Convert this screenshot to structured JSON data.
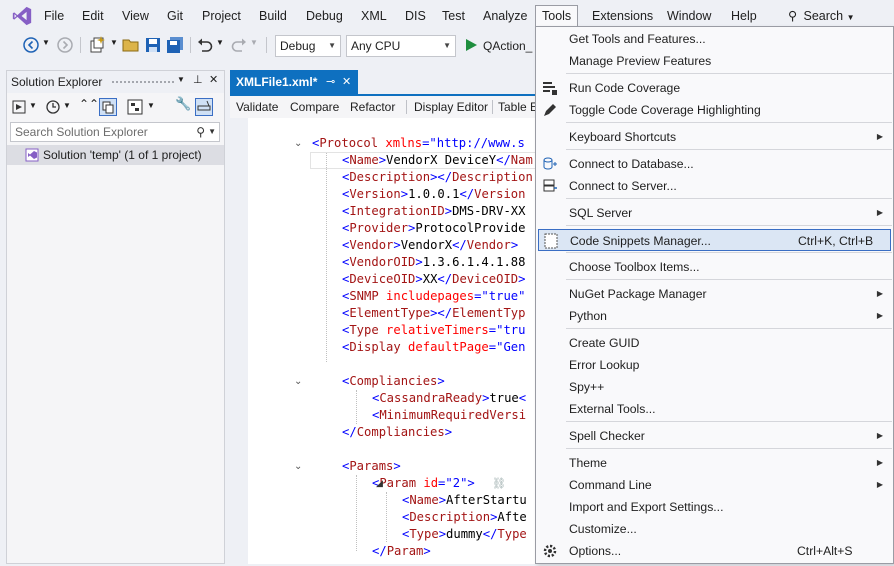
{
  "menubar": {
    "items": [
      "File",
      "Edit",
      "View",
      "Git",
      "Project",
      "Build",
      "Debug",
      "XML",
      "DIS",
      "Test",
      "Analyze",
      "Tools",
      "Extensions",
      "Window",
      "Help"
    ],
    "search_label": "Search"
  },
  "toolbar": {
    "config": "Debug",
    "platform": "Any CPU",
    "run_target": "QAction_"
  },
  "solution_explorer": {
    "title": "Solution Explorer",
    "search_placeholder": "Search Solution Explorer",
    "solution_item": "Solution 'temp' (1 of 1 project)"
  },
  "editor": {
    "tab_title": "XMLFile1.xml*",
    "tab_pin": "⊸",
    "tab_close": "✕",
    "toolbar_buttons": [
      "Validate",
      "Compare",
      "Refactor",
      "Display Editor",
      "Table E"
    ],
    "lines": [
      [
        [
          "br",
          "<"
        ],
        [
          "tg",
          "Protocol"
        ],
        [
          "at",
          " xmlns"
        ],
        [
          "br",
          "=\""
        ],
        [
          "vl",
          "http://www.s"
        ]
      ],
      [
        [
          "br",
          "<"
        ],
        [
          "tg",
          "Name"
        ],
        [
          "br",
          ">"
        ],
        [
          "tx",
          "VendorX DeviceY"
        ],
        [
          "br",
          "</"
        ],
        [
          "tg",
          "Nam"
        ]
      ],
      [
        [
          "br",
          "<"
        ],
        [
          "tg",
          "Description"
        ],
        [
          "br",
          "></"
        ],
        [
          "tg",
          "Description"
        ]
      ],
      [
        [
          "br",
          "<"
        ],
        [
          "tg",
          "Version"
        ],
        [
          "br",
          ">"
        ],
        [
          "tx",
          "1.0.0.1"
        ],
        [
          "br",
          "</"
        ],
        [
          "tg",
          "Version"
        ]
      ],
      [
        [
          "br",
          "<"
        ],
        [
          "tg",
          "IntegrationID"
        ],
        [
          "br",
          ">"
        ],
        [
          "tx",
          "DMS-DRV-XX"
        ]
      ],
      [
        [
          "br",
          "<"
        ],
        [
          "tg",
          "Provider"
        ],
        [
          "br",
          ">"
        ],
        [
          "tx",
          "ProtocolProvide"
        ]
      ],
      [
        [
          "br",
          "<"
        ],
        [
          "tg",
          "Vendor"
        ],
        [
          "br",
          ">"
        ],
        [
          "tx",
          "VendorX"
        ],
        [
          "br",
          "</"
        ],
        [
          "tg",
          "Vendor"
        ],
        [
          "br",
          ">"
        ]
      ],
      [
        [
          "br",
          "<"
        ],
        [
          "tg",
          "VendorOID"
        ],
        [
          "br",
          ">"
        ],
        [
          "tx",
          "1.3.6.1.4.1.88"
        ]
      ],
      [
        [
          "br",
          "<"
        ],
        [
          "tg",
          "DeviceOID"
        ],
        [
          "br",
          ">"
        ],
        [
          "tx",
          "XX"
        ],
        [
          "br",
          "</"
        ],
        [
          "tg",
          "DeviceOID"
        ],
        [
          "br",
          ">"
        ]
      ],
      [
        [
          "br",
          "<"
        ],
        [
          "tg",
          "SNMP"
        ],
        [
          "at",
          " includepages"
        ],
        [
          "br",
          "=\""
        ],
        [
          "vl",
          "true"
        ],
        [
          "br",
          "\""
        ]
      ],
      [
        [
          "br",
          "<"
        ],
        [
          "tg",
          "ElementType"
        ],
        [
          "br",
          "></"
        ],
        [
          "tg",
          "ElementTyp"
        ]
      ],
      [
        [
          "br",
          "<"
        ],
        [
          "tg",
          "Type"
        ],
        [
          "at",
          " relativeTimers"
        ],
        [
          "br",
          "=\""
        ],
        [
          "vl",
          "tru"
        ]
      ],
      [
        [
          "br",
          "<"
        ],
        [
          "tg",
          "Display"
        ],
        [
          "at",
          " defaultPage"
        ],
        [
          "br",
          "=\""
        ],
        [
          "vl",
          "Gen"
        ]
      ],
      [],
      [
        [
          "br",
          "<"
        ],
        [
          "tg",
          "Compliancies"
        ],
        [
          "br",
          ">"
        ]
      ],
      [
        [
          "br",
          "<"
        ],
        [
          "tg",
          "CassandraReady"
        ],
        [
          "br",
          ">"
        ],
        [
          "tx",
          "true"
        ],
        [
          "br",
          "<"
        ]
      ],
      [
        [
          "br",
          "<"
        ],
        [
          "tg",
          "MinimumRequiredVersi"
        ]
      ],
      [
        [
          "br",
          "</"
        ],
        [
          "tg",
          "Compliancies"
        ],
        [
          "br",
          ">"
        ]
      ],
      [],
      [
        [
          "br",
          "<"
        ],
        [
          "tg",
          "Params"
        ],
        [
          "br",
          ">"
        ]
      ],
      [
        [
          "br",
          "<"
        ],
        [
          "tg",
          "Param"
        ],
        [
          "at",
          " id"
        ],
        [
          "br",
          "=\""
        ],
        [
          "vl",
          "2"
        ],
        [
          "br",
          "\">"
        ]
      ],
      [
        [
          "br",
          "<"
        ],
        [
          "tg",
          "Name"
        ],
        [
          "br",
          ">"
        ],
        [
          "tx",
          "AfterStartu"
        ]
      ],
      [
        [
          "br",
          "<"
        ],
        [
          "tg",
          "Description"
        ],
        [
          "br",
          ">"
        ],
        [
          "tx",
          "Afte"
        ]
      ],
      [
        [
          "br",
          "<"
        ],
        [
          "tg",
          "Type"
        ],
        [
          "br",
          ">"
        ],
        [
          "tx",
          "dummy"
        ],
        [
          "br",
          "</"
        ],
        [
          "tg",
          "Type"
        ]
      ],
      [
        [
          "br",
          "</"
        ],
        [
          "tg",
          "Param"
        ],
        [
          "br",
          ">"
        ]
      ]
    ]
  },
  "tools_menu": {
    "items": [
      {
        "label": "Get Tools and Features...",
        "shortcut": "",
        "icon": "",
        "submenu": false
      },
      {
        "label": "Manage Preview Features",
        "shortcut": "",
        "icon": "",
        "submenu": false
      },
      {
        "label": "Run Code Coverage",
        "shortcut": "",
        "icon": "code-coverage-icon",
        "submenu": false
      },
      {
        "label": "Toggle Code Coverage Highlighting",
        "shortcut": "",
        "icon": "highlight-pen-icon",
        "submenu": false
      },
      {
        "label": "Keyboard Shortcuts",
        "shortcut": "",
        "icon": "",
        "submenu": true
      },
      {
        "label": "Connect to Database...",
        "shortcut": "",
        "icon": "database-connect-icon",
        "submenu": false
      },
      {
        "label": "Connect to Server...",
        "shortcut": "",
        "icon": "server-connect-icon",
        "submenu": false
      },
      {
        "label": "SQL Server",
        "shortcut": "",
        "icon": "",
        "submenu": true
      },
      {
        "label": "Code Snippets Manager...",
        "shortcut": "Ctrl+K, Ctrl+B",
        "icon": "snippet-icon",
        "submenu": false
      },
      {
        "label": "Choose Toolbox Items...",
        "shortcut": "",
        "icon": "",
        "submenu": false
      },
      {
        "label": "NuGet Package Manager",
        "shortcut": "",
        "icon": "",
        "submenu": true
      },
      {
        "label": "Python",
        "shortcut": "",
        "icon": "",
        "submenu": true
      },
      {
        "label": "Create GUID",
        "shortcut": "",
        "icon": "",
        "submenu": false
      },
      {
        "label": "Error Lookup",
        "shortcut": "",
        "icon": "",
        "submenu": false
      },
      {
        "label": "Spy++",
        "shortcut": "",
        "icon": "",
        "submenu": false
      },
      {
        "label": "External Tools...",
        "shortcut": "",
        "icon": "",
        "submenu": false
      },
      {
        "label": "Spell Checker",
        "shortcut": "",
        "icon": "",
        "submenu": true
      },
      {
        "label": "Theme",
        "shortcut": "",
        "icon": "",
        "submenu": true
      },
      {
        "label": "Command Line",
        "shortcut": "",
        "icon": "",
        "submenu": true
      },
      {
        "label": "Import and Export Settings...",
        "shortcut": "",
        "icon": "",
        "submenu": false
      },
      {
        "label": "Customize...",
        "shortcut": "",
        "icon": "",
        "submenu": false
      },
      {
        "label": "Options...",
        "shortcut": "Ctrl+Alt+S",
        "icon": "gear-icon",
        "submenu": false
      }
    ]
  },
  "colors": {
    "accent": "#0e70c0",
    "highlight_bg": "#dbe6f4",
    "highlight_border": "#3a6ec4",
    "vs_purple": "#865fc5"
  }
}
